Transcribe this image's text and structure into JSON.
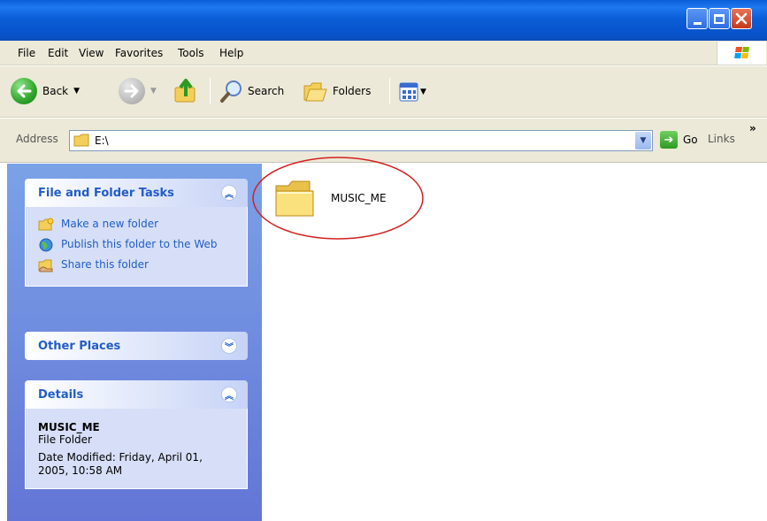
{
  "window": {
    "minimize_label": "minimize",
    "maximize_label": "maximize",
    "close_label": "close"
  },
  "menu": {
    "items": [
      "File",
      "Edit",
      "View",
      "Favorites",
      "Tools",
      "Help"
    ]
  },
  "toolbar": {
    "back_label": "Back",
    "search_label": "Search",
    "folders_label": "Folders"
  },
  "address": {
    "label": "Address",
    "value": "E:\\",
    "go_label": "Go",
    "links_label": "Links"
  },
  "file_folder_tasks": {
    "title": "File and Folder Tasks",
    "items": [
      {
        "label": "Make a new folder",
        "icon": "new-folder-icon"
      },
      {
        "label": "Publish this folder to the Web",
        "icon": "web-publish-icon"
      },
      {
        "label": "Share this folder",
        "icon": "share-folder-icon"
      }
    ]
  },
  "other_places": {
    "title": "Other Places"
  },
  "details": {
    "title": "Details",
    "name": "MUSIC_ME",
    "type": "File Folder",
    "date_modified": "Date Modified: Friday, April 01, 2005, 10:58 AM"
  },
  "folders": [
    {
      "name": "MUSIC_ME",
      "icon": "folder-icon"
    }
  ],
  "colors": {
    "titlebar": "#0a5fd8",
    "task_pane": "#7ba2e7",
    "task_link": "#215dc6",
    "annotation": "#d42020"
  }
}
